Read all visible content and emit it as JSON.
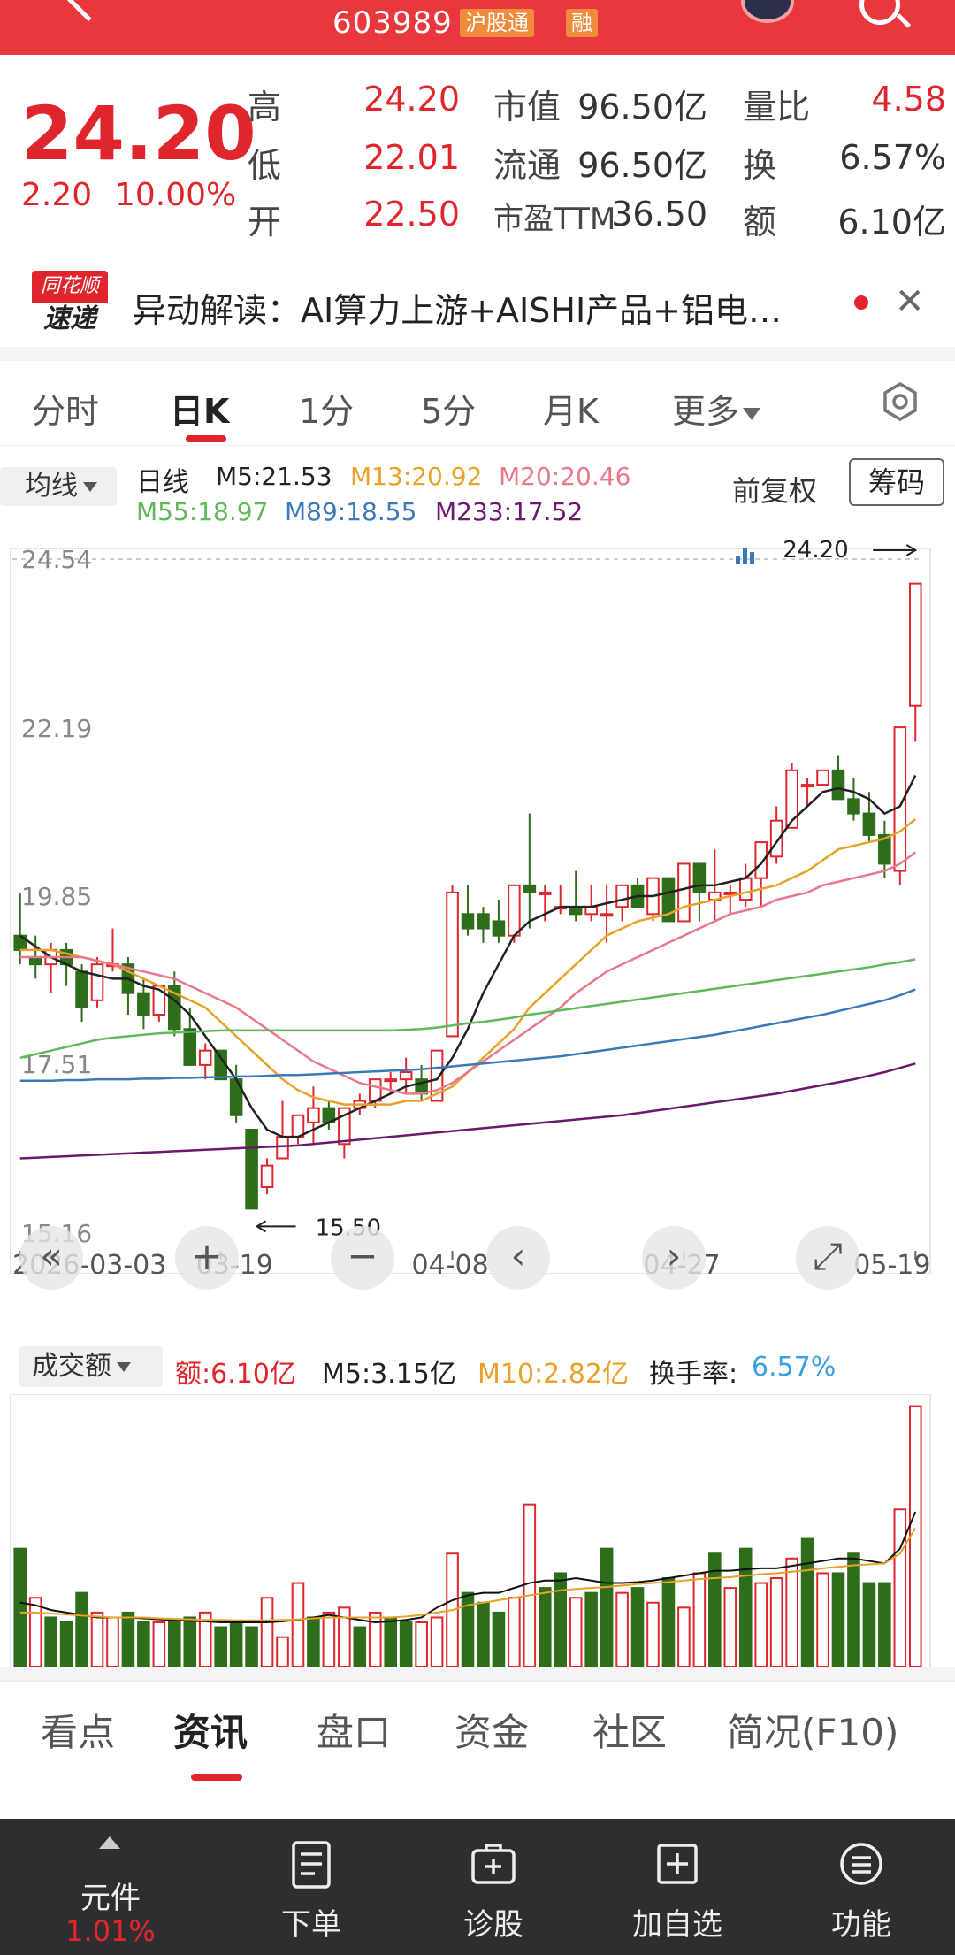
{
  "header": {
    "code": "603989",
    "badge1": "沪股通",
    "badge2": "融"
  },
  "quote": {
    "price": "24.20",
    "change": "2.20",
    "change_pct": "10.00%",
    "high_label": "高",
    "high": "24.20",
    "low_label": "低",
    "low": "22.01",
    "open_label": "开",
    "open": "22.50",
    "mcap_label": "市值",
    "mcap": "96.50亿",
    "float_label": "流通",
    "float": "96.50亿",
    "pe_label": "市盈TTM",
    "pe": "36.50",
    "vr_label": "量比",
    "vr": "4.58",
    "turn_label": "换",
    "turn": "6.57%",
    "amt_label": "额",
    "amt": "6.10亿"
  },
  "news": {
    "logo_top": "同花顺",
    "logo_bottom": "速递",
    "text": "异动解读：AI算力上游+AISHI产品+铝电…",
    "close_icon": "close-icon"
  },
  "period_tabs": [
    "分时",
    "日K",
    "1分",
    "5分",
    "月K",
    "更多"
  ],
  "ma": {
    "dropdown": "均线",
    "period": "日线",
    "m5": "M5:21.53",
    "m13": "M13:20.92",
    "m20": "M20:20.46",
    "m55": "M55:18.97",
    "m89": "M89:18.55",
    "m233": "M233:17.52",
    "fuquan": "前复权",
    "chouma": "筹码",
    "colors": {
      "m5": "#222222",
      "m13": "#e8a22a",
      "m20": "#e8788a",
      "m55": "#5fb85a",
      "m89": "#3a7ab8",
      "m233": "#6a1a6a"
    }
  },
  "chart_data": {
    "type": "candlestick",
    "y_ticks": [
      "24.54",
      "22.19",
      "19.85",
      "17.51",
      "15.16"
    ],
    "x_ticks": [
      "2026-03-03",
      "03-19",
      "04-08",
      "04-27",
      "05-19"
    ],
    "max_label": "24.20",
    "min_label": "15.50",
    "ylim": [
      15.16,
      24.54
    ],
    "up_color": "#e0262c",
    "down_color": "#2e6e1a",
    "candles": [
      [
        19.3,
        19.9,
        18.9,
        19.1
      ],
      [
        19.0,
        19.3,
        18.7,
        18.9
      ],
      [
        18.9,
        19.2,
        18.5,
        19.1
      ],
      [
        19.1,
        19.2,
        18.6,
        18.9
      ],
      [
        18.8,
        18.9,
        18.1,
        18.3
      ],
      [
        18.4,
        19.0,
        18.3,
        18.9
      ],
      [
        18.9,
        19.4,
        18.8,
        18.9
      ],
      [
        18.9,
        19.0,
        18.2,
        18.5
      ],
      [
        18.5,
        18.7,
        18.0,
        18.2
      ],
      [
        18.2,
        18.6,
        18.1,
        18.6
      ],
      [
        18.6,
        18.8,
        17.9,
        18.0
      ],
      [
        18.0,
        18.3,
        17.5,
        17.5
      ],
      [
        17.5,
        17.8,
        17.3,
        17.7
      ],
      [
        17.7,
        17.7,
        17.3,
        17.3
      ],
      [
        17.3,
        17.5,
        16.7,
        16.8
      ],
      [
        16.6,
        16.6,
        15.5,
        15.5
      ],
      [
        15.8,
        16.2,
        15.7,
        16.1
      ],
      [
        16.2,
        17.0,
        16.2,
        16.5
      ],
      [
        16.5,
        16.8,
        16.4,
        16.8
      ],
      [
        16.7,
        17.2,
        16.4,
        16.9
      ],
      [
        16.9,
        17.0,
        16.6,
        16.7
      ],
      [
        16.4,
        16.9,
        16.2,
        16.9
      ],
      [
        16.9,
        17.1,
        16.8,
        17.0
      ],
      [
        17.0,
        17.3,
        16.9,
        17.3
      ],
      [
        17.3,
        17.4,
        17.1,
        17.3
      ],
      [
        17.3,
        17.6,
        17.1,
        17.4
      ],
      [
        17.3,
        17.5,
        17.0,
        17.1
      ],
      [
        17.0,
        17.7,
        17.0,
        17.7
      ],
      [
        17.9,
        20.0,
        17.9,
        19.9
      ],
      [
        19.6,
        20.0,
        19.3,
        19.4
      ],
      [
        19.6,
        19.7,
        19.2,
        19.4
      ],
      [
        19.5,
        19.8,
        19.2,
        19.3
      ],
      [
        19.3,
        20.0,
        19.2,
        20.0
      ],
      [
        20.0,
        21.0,
        19.4,
        19.9
      ],
      [
        19.9,
        20.0,
        19.5,
        19.9
      ],
      [
        19.7,
        20.0,
        19.6,
        19.7
      ],
      [
        19.7,
        20.2,
        19.5,
        19.6
      ],
      [
        19.6,
        20.0,
        19.5,
        19.7
      ],
      [
        19.6,
        20.0,
        19.2,
        19.6
      ],
      [
        19.7,
        20.0,
        19.5,
        20.0
      ],
      [
        20.0,
        20.1,
        19.7,
        19.7
      ],
      [
        19.6,
        20.0,
        19.5,
        20.1
      ],
      [
        20.1,
        20.1,
        19.5,
        19.5
      ],
      [
        19.5,
        20.3,
        19.5,
        20.3
      ],
      [
        20.3,
        20.3,
        19.5,
        19.9
      ],
      [
        19.8,
        20.5,
        19.5,
        19.9
      ],
      [
        19.9,
        20.0,
        19.6,
        19.9
      ],
      [
        19.8,
        20.3,
        19.7,
        20.1
      ],
      [
        20.1,
        20.5,
        19.7,
        20.6
      ],
      [
        20.4,
        21.1,
        20.3,
        20.9
      ],
      [
        20.8,
        21.7,
        20.8,
        21.6
      ],
      [
        21.4,
        21.5,
        21.1,
        21.4
      ],
      [
        21.4,
        21.6,
        21.4,
        21.6
      ],
      [
        21.6,
        21.8,
        21.2,
        21.2
      ],
      [
        21.2,
        21.5,
        20.9,
        21.0
      ],
      [
        21.0,
        21.3,
        20.6,
        20.7
      ],
      [
        20.7,
        20.9,
        20.1,
        20.3
      ],
      [
        20.2,
        22.2,
        20.0,
        22.2
      ],
      [
        22.5,
        24.2,
        22.0,
        24.2
      ]
    ],
    "ma_lines": {
      "m5": [
        19.3,
        19.15,
        19.0,
        18.9,
        18.8,
        18.75,
        18.7,
        18.7,
        18.6,
        18.55,
        18.4,
        18.2,
        17.9,
        17.6,
        17.3,
        16.9,
        16.6,
        16.5,
        16.5,
        16.6,
        16.7,
        16.8,
        16.9,
        17.0,
        17.1,
        17.2,
        17.25,
        17.3,
        17.6,
        18.0,
        18.5,
        18.9,
        19.3,
        19.5,
        19.6,
        19.7,
        19.7,
        19.7,
        19.75,
        19.8,
        19.85,
        19.85,
        19.9,
        19.95,
        20.0,
        20.0,
        20.05,
        20.1,
        20.3,
        20.6,
        20.9,
        21.1,
        21.3,
        21.35,
        21.3,
        21.2,
        21.0,
        21.1,
        21.53
      ],
      "m13": [
        19.1,
        19.1,
        19.1,
        19.05,
        19.0,
        18.95,
        18.9,
        18.8,
        18.7,
        18.6,
        18.5,
        18.4,
        18.3,
        18.1,
        17.9,
        17.7,
        17.5,
        17.3,
        17.15,
        17.05,
        17.0,
        16.95,
        16.95,
        16.95,
        16.95,
        17.0,
        17.0,
        17.1,
        17.2,
        17.4,
        17.6,
        17.8,
        18.0,
        18.3,
        18.5,
        18.7,
        18.9,
        19.1,
        19.3,
        19.4,
        19.5,
        19.55,
        19.6,
        19.7,
        19.75,
        19.8,
        19.85,
        19.9,
        19.95,
        20.0,
        20.1,
        20.2,
        20.35,
        20.5,
        20.55,
        20.6,
        20.65,
        20.75,
        20.92
      ],
      "m20": [
        19.0,
        19.0,
        19.0,
        19.0,
        19.0,
        18.95,
        18.9,
        18.85,
        18.8,
        18.75,
        18.7,
        18.6,
        18.5,
        18.4,
        18.3,
        18.15,
        18.0,
        17.85,
        17.7,
        17.55,
        17.45,
        17.35,
        17.25,
        17.2,
        17.15,
        17.1,
        17.1,
        17.15,
        17.25,
        17.4,
        17.55,
        17.7,
        17.85,
        18.0,
        18.15,
        18.3,
        18.5,
        18.65,
        18.8,
        18.9,
        19.0,
        19.1,
        19.2,
        19.3,
        19.4,
        19.5,
        19.6,
        19.65,
        19.7,
        19.8,
        19.85,
        19.9,
        20.0,
        20.05,
        20.1,
        20.15,
        20.2,
        20.3,
        20.46
      ],
      "m55": [
        17.6,
        17.65,
        17.7,
        17.75,
        17.8,
        17.85,
        17.88,
        17.9,
        17.92,
        17.94,
        17.95,
        17.96,
        17.97,
        17.98,
        17.98,
        17.98,
        17.98,
        17.98,
        17.98,
        17.98,
        17.98,
        17.98,
        17.98,
        17.98,
        17.98,
        17.99,
        18.0,
        18.02,
        18.05,
        18.08,
        18.1,
        18.13,
        18.16,
        18.2,
        18.23,
        18.26,
        18.29,
        18.32,
        18.35,
        18.38,
        18.41,
        18.44,
        18.47,
        18.5,
        18.53,
        18.56,
        18.59,
        18.62,
        18.65,
        18.68,
        18.71,
        18.74,
        18.77,
        18.8,
        18.83,
        18.86,
        18.9,
        18.93,
        18.97
      ],
      "m89": [
        17.28,
        17.28,
        17.28,
        17.29,
        17.29,
        17.3,
        17.3,
        17.3,
        17.31,
        17.31,
        17.32,
        17.32,
        17.33,
        17.33,
        17.34,
        17.34,
        17.35,
        17.36,
        17.36,
        17.37,
        17.38,
        17.39,
        17.4,
        17.41,
        17.42,
        17.43,
        17.44,
        17.46,
        17.48,
        17.5,
        17.52,
        17.54,
        17.56,
        17.58,
        17.6,
        17.62,
        17.65,
        17.68,
        17.71,
        17.74,
        17.77,
        17.8,
        17.83,
        17.86,
        17.89,
        17.92,
        17.96,
        18.0,
        18.04,
        18.08,
        18.12,
        18.16,
        18.2,
        18.25,
        18.3,
        18.35,
        18.4,
        18.47,
        18.55
      ],
      "m233": [
        16.2,
        16.21,
        16.22,
        16.23,
        16.24,
        16.25,
        16.26,
        16.27,
        16.28,
        16.29,
        16.3,
        16.31,
        16.32,
        16.33,
        16.34,
        16.35,
        16.36,
        16.37,
        16.38,
        16.4,
        16.42,
        16.44,
        16.46,
        16.48,
        16.5,
        16.52,
        16.54,
        16.56,
        16.58,
        16.6,
        16.62,
        16.64,
        16.66,
        16.68,
        16.7,
        16.72,
        16.74,
        16.76,
        16.78,
        16.8,
        16.83,
        16.86,
        16.89,
        16.92,
        16.95,
        16.98,
        17.01,
        17.04,
        17.07,
        17.1,
        17.14,
        17.18,
        17.22,
        17.26,
        17.3,
        17.35,
        17.4,
        17.46,
        17.52
      ]
    },
    "controls": [
      "«",
      "+",
      "−",
      "‹",
      "›",
      "⤢"
    ]
  },
  "volume": {
    "dropdown": "成交额",
    "amt": "额:6.10亿",
    "m5": "M5:3.15亿",
    "m10": "M10:2.82亿",
    "turn_label": "换手率:",
    "turn": "6.57%",
    "values": [
      2.4,
      1.4,
      1.0,
      0.9,
      1.5,
      1.1,
      1.0,
      1.1,
      0.9,
      0.9,
      0.9,
      1.0,
      1.1,
      0.8,
      0.9,
      0.8,
      1.4,
      0.6,
      1.7,
      1.0,
      1.1,
      1.2,
      0.8,
      1.1,
      1.0,
      0.9,
      0.9,
      1.0,
      2.3,
      1.5,
      1.3,
      1.1,
      1.4,
      3.3,
      1.6,
      1.9,
      1.4,
      1.5,
      2.4,
      1.5,
      1.6,
      1.3,
      1.8,
      1.2,
      1.9,
      2.3,
      1.6,
      2.4,
      1.7,
      1.8,
      2.2,
      2.6,
      1.9,
      1.9,
      2.3,
      1.7,
      1.7,
      3.2,
      5.3
    ],
    "up": [
      false,
      true,
      false,
      false,
      false,
      true,
      true,
      false,
      false,
      true,
      false,
      false,
      true,
      false,
      false,
      false,
      true,
      true,
      true,
      false,
      true,
      true,
      false,
      true,
      false,
      false,
      true,
      true,
      true,
      false,
      false,
      false,
      true,
      true,
      false,
      false,
      true,
      false,
      false,
      true,
      false,
      true,
      false,
      true,
      true,
      false,
      true,
      false,
      true,
      true,
      true,
      false,
      true,
      false,
      false,
      false,
      false,
      true,
      true
    ],
    "ma5": [
      1.3,
      1.25,
      1.15,
      1.1,
      1.05,
      1.0,
      1.0,
      1.0,
      0.98,
      0.96,
      0.95,
      0.93,
      0.92,
      0.9,
      0.9,
      0.9,
      0.9,
      0.92,
      0.95,
      1.0,
      1.05,
      1.0,
      0.95,
      0.9,
      0.92,
      0.95,
      1.0,
      1.2,
      1.35,
      1.45,
      1.5,
      1.5,
      1.6,
      1.7,
      1.75,
      1.75,
      1.8,
      1.75,
      1.7,
      1.7,
      1.72,
      1.75,
      1.8,
      1.85,
      1.9,
      1.95,
      1.95,
      1.98,
      2.0,
      2.0,
      2.05,
      2.1,
      2.15,
      2.2,
      2.2,
      2.15,
      2.1,
      2.4,
      3.15
    ],
    "ma10": [
      1.1,
      1.1,
      1.08,
      1.06,
      1.04,
      1.02,
      1.0,
      1.0,
      1.0,
      0.98,
      0.97,
      0.96,
      0.95,
      0.95,
      0.94,
      0.94,
      0.94,
      0.95,
      0.96,
      0.98,
      1.0,
      1.0,
      1.0,
      1.0,
      1.0,
      1.02,
      1.05,
      1.1,
      1.15,
      1.25,
      1.3,
      1.35,
      1.4,
      1.45,
      1.5,
      1.55,
      1.58,
      1.6,
      1.62,
      1.65,
      1.68,
      1.7,
      1.72,
      1.75,
      1.78,
      1.8,
      1.82,
      1.85,
      1.88,
      1.9,
      1.93,
      1.96,
      2.0,
      2.03,
      2.06,
      2.08,
      2.1,
      2.3,
      2.82
    ],
    "ma5_color": "#111111",
    "ma10_color": "#e8a22a"
  },
  "bottom_tabs": [
    "看点",
    "资讯",
    "盘口",
    "资金",
    "社区",
    "简况(F10)"
  ],
  "actionbar": {
    "first_label": "元件",
    "first_pct": "1.01%",
    "items": [
      {
        "label": "下单",
        "icon": "order-icon"
      },
      {
        "label": "诊股",
        "icon": "diagnose-icon"
      },
      {
        "label": "加自选",
        "icon": "add-watchlist-icon"
      },
      {
        "label": "功能",
        "icon": "menu-icon"
      }
    ]
  }
}
